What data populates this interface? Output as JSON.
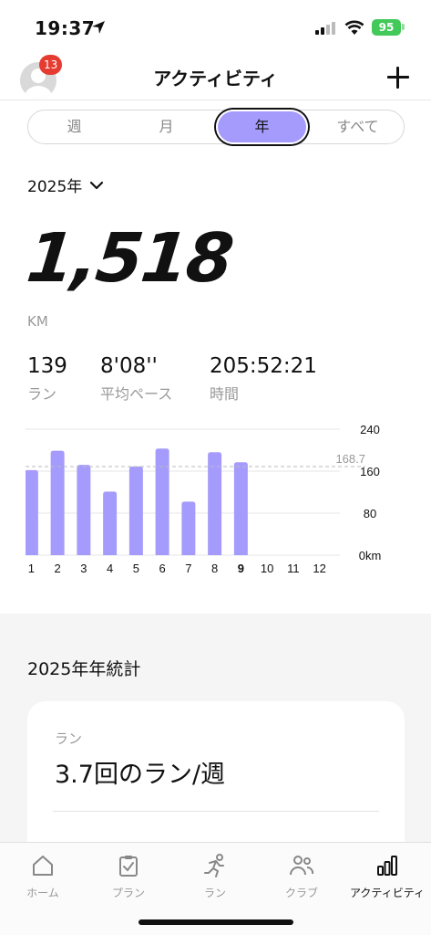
{
  "status_bar": {
    "time": "19:37",
    "battery": "95"
  },
  "header": {
    "title": "アクティビティ",
    "notification_count": "13"
  },
  "segments": [
    {
      "label": "週",
      "active": false
    },
    {
      "label": "月",
      "active": false
    },
    {
      "label": "年",
      "active": true
    },
    {
      "label": "すべて",
      "active": false
    }
  ],
  "year_selector": {
    "label": "2025年"
  },
  "summary": {
    "distance": "1,518",
    "unit": "KM",
    "stats": [
      {
        "value": "139",
        "label": "ラン"
      },
      {
        "value": "8'08''",
        "label": "平均ペース"
      },
      {
        "value": "205:52:21",
        "label": "時間"
      }
    ]
  },
  "chart_data": {
    "type": "bar",
    "categories": [
      "1",
      "2",
      "3",
      "4",
      "5",
      "6",
      "7",
      "8",
      "9",
      "10",
      "11",
      "12"
    ],
    "values": [
      162,
      199,
      172,
      121,
      169,
      203,
      102,
      196,
      177,
      0,
      0,
      0
    ],
    "average": 168.7,
    "average_label": "168.7",
    "ylim": [
      0,
      240
    ],
    "y_ticks": [
      {
        "value": 240,
        "label": "240"
      },
      {
        "value": 160,
        "label": "160"
      },
      {
        "value": 80,
        "label": "80"
      },
      {
        "value": 0,
        "label": "0km"
      }
    ],
    "bar_color": "#a59bfc",
    "current_month": "9"
  },
  "stats_section": {
    "title": "2025年年統計",
    "card": {
      "label": "ラン",
      "value": "3.7回のラン/週"
    }
  },
  "tab_bar": [
    {
      "label": "ホーム",
      "icon": "home-icon",
      "active": false
    },
    {
      "label": "プラン",
      "icon": "clipboard-icon",
      "active": false
    },
    {
      "label": "ラン",
      "icon": "runner-icon",
      "active": false
    },
    {
      "label": "クラブ",
      "icon": "people-icon",
      "active": false
    },
    {
      "label": "アクティビティ",
      "icon": "bar-chart-icon",
      "active": true
    }
  ],
  "colors": {
    "accent": "#a59bfc",
    "badge": "#e53b30",
    "battery": "#41c95a"
  }
}
